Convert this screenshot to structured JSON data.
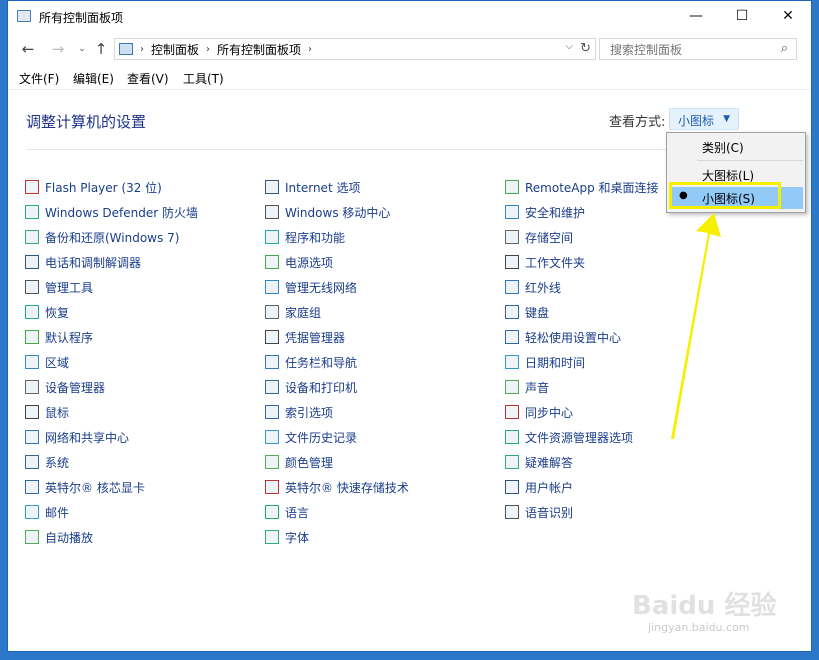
{
  "window": {
    "title": "所有控制面板项"
  },
  "address": {
    "crumbs": [
      "控制面板",
      "所有控制面板项"
    ]
  },
  "search": {
    "placeholder": "搜索控制面板"
  },
  "menubar": [
    "文件(F)",
    "编辑(E)",
    "查看(V)",
    "工具(T)"
  ],
  "heading": "调整计算机的设置",
  "viewby": {
    "label": "查看方式:",
    "value": "小图标"
  },
  "view_menu": {
    "options": [
      "类别(C)",
      "大图标(L)",
      "小图标(S)"
    ],
    "selected": "小图标(S)"
  },
  "columns": [
    [
      "Flash Player (32 位)",
      "Windows Defender 防火墙",
      "备份和还原(Windows 7)",
      "电话和调制解调器",
      "管理工具",
      "恢复",
      "默认程序",
      "区域",
      "设备管理器",
      "鼠标",
      "网络和共享中心",
      "系统",
      "英特尔® 核芯显卡",
      "邮件",
      "自动播放"
    ],
    [
      "Internet 选项",
      "Windows 移动中心",
      "程序和功能",
      "电源选项",
      "管理无线网络",
      "家庭组",
      "凭据管理器",
      "任务栏和导航",
      "设备和打印机",
      "索引选项",
      "文件历史记录",
      "颜色管理",
      "英特尔® 快速存储技术",
      "语言",
      "字体"
    ],
    [
      "RemoteApp 和桌面连接",
      "安全和维护",
      "存储空间",
      "工作文件夹",
      "红外线",
      "键盘",
      "轻松使用设置中心",
      "日期和时间",
      "声音",
      "同步中心",
      "文件资源管理器选项",
      "疑难解答",
      "用户帐户",
      "语音识别"
    ]
  ],
  "watermark": {
    "brand": "Baidu 经验",
    "url": "jingyan.baidu.com"
  },
  "colors": {
    "accent": "#1a5fb4",
    "highlight": "#f6f000",
    "selected": "#91c9f7"
  }
}
